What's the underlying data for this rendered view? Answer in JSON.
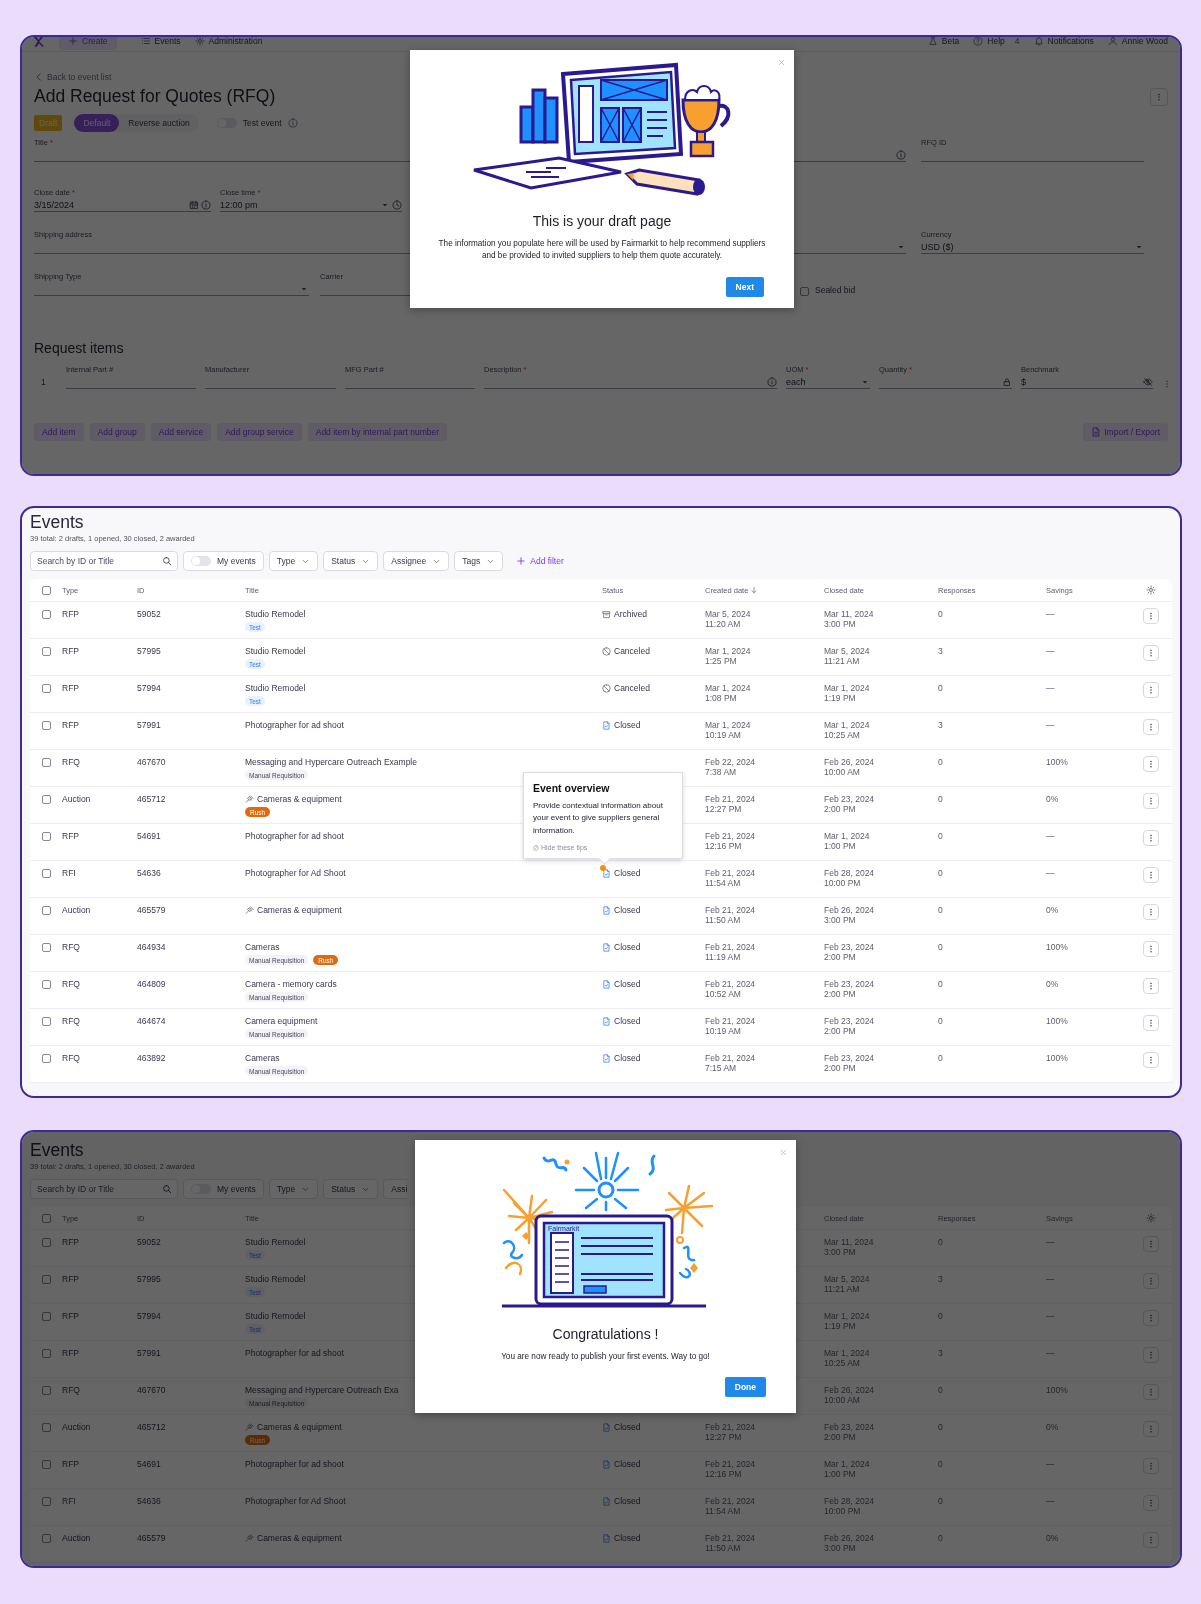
{
  "draft_screen": {
    "nav": {
      "create": "Create",
      "items": [
        {
          "label": "Events"
        },
        {
          "label": "Administration"
        }
      ],
      "right": [
        {
          "label": "Beta"
        },
        {
          "label": "Help",
          "count": "4"
        },
        {
          "label": "Notifications"
        },
        {
          "label": "Annie Wood"
        }
      ]
    },
    "back_link": "Back to event list",
    "title": "Add Request for Quotes (RFQ)",
    "status_badge": "Draft",
    "event_types": [
      {
        "label": "Default",
        "selected": true
      },
      {
        "label": "Reverse auction",
        "selected": false
      }
    ],
    "test_event": {
      "label": "Test event",
      "on": false
    },
    "form": {
      "title_field": {
        "label": "Title",
        "required": "*"
      },
      "rfq_id": {
        "label": "RFQ ID"
      },
      "close_date": {
        "label": "Close date",
        "required": "*",
        "value": "3/15/2024"
      },
      "close_time": {
        "label": "Close time",
        "required": "*",
        "value": "12:00 pm"
      },
      "shipping_address": {
        "label": "Shipping address"
      },
      "currency": {
        "label": "Currency",
        "value": "USD ($)"
      },
      "shipping_type": {
        "label": "Shipping Type"
      },
      "carrier": {
        "label": "Carrier"
      },
      "sealed_bid": {
        "label": "Sealed bid",
        "checked": false
      }
    },
    "request_items": {
      "heading": "Request items",
      "rows": [
        {
          "number": "1",
          "fields": [
            {
              "label": "Internal Part #"
            },
            {
              "label": "Manufacturer"
            },
            {
              "label": "MFG Part #"
            },
            {
              "label": "Description",
              "required": "*"
            },
            {
              "label": "UOM",
              "required": "*",
              "value": "each"
            },
            {
              "label": "Quantity",
              "required": "*"
            },
            {
              "label": "Benchmark",
              "value": "$"
            }
          ]
        }
      ]
    },
    "item_buttons": [
      "Add item",
      "Add group",
      "Add service",
      "Add group service",
      "Add item by internal part number"
    ],
    "import_export": "Import / Export",
    "modal": {
      "title": "This is your draft page",
      "body": "The information you populate here will be used by Fairmarkit to help recommend suppliers and be provided to invited suppliers to help them quote accurately.",
      "button": "Next"
    }
  },
  "event_lists": [
    {
      "title": "Events",
      "summary": "39 total: 2 drafts, 1 opened, 30 closed, 2 awarded",
      "search": {
        "placeholder": "Search by ID or Title"
      },
      "my_events": {
        "label": "My events",
        "on": false
      },
      "filters": [
        {
          "label": "Type",
          "cut": false
        },
        {
          "label": "Status",
          "cut": false
        },
        {
          "label": "Assignee",
          "cut": false
        },
        {
          "label": "Tags",
          "cut": false
        }
      ],
      "add_filter": "Add filter",
      "all_checked": false,
      "columns": [
        {
          "kind": "type",
          "label": "Type",
          "sorted": false
        },
        {
          "kind": "id",
          "label": "ID",
          "sorted": false
        },
        {
          "kind": "title",
          "label": "Title",
          "sorted": false
        },
        {
          "kind": "status",
          "label": "Status",
          "sorted": false
        },
        {
          "kind": "created",
          "label": "Created date",
          "sorted": true
        },
        {
          "kind": "closed",
          "label": "Closed date",
          "sorted": false
        },
        {
          "kind": "responses",
          "label": "Responses",
          "sorted": false
        },
        {
          "kind": "savings",
          "label": "Savings",
          "sorted": false
        }
      ],
      "rows": [
        {
          "type": "RFP",
          "id": "59052",
          "title": "Studio Remodel",
          "gavel": false,
          "tags": [
            {
              "label": "Test",
              "kind": "test"
            }
          ],
          "status": {
            "kind": "archived",
            "label": "Archived"
          },
          "created": {
            "date": "Mar 5, 2024",
            "time": "11:20 AM"
          },
          "closed": {
            "date": "Mar 11, 2024",
            "time": "3:00 PM"
          },
          "responses": "0",
          "savings": "—",
          "checked": false,
          "beacon": false
        },
        {
          "type": "RFP",
          "id": "57995",
          "title": "Studio Remodel",
          "gavel": false,
          "tags": [
            {
              "label": "Test",
              "kind": "test"
            }
          ],
          "status": {
            "kind": "canceled",
            "label": "Canceled"
          },
          "created": {
            "date": "Mar 1, 2024",
            "time": "1:25 PM"
          },
          "closed": {
            "date": "Mar 5, 2024",
            "time": "11:21 AM"
          },
          "responses": "3",
          "savings": "—",
          "checked": false,
          "beacon": false
        },
        {
          "type": "RFP",
          "id": "57994",
          "title": "Studio Remodel",
          "gavel": false,
          "tags": [
            {
              "label": "Test",
              "kind": "test"
            }
          ],
          "status": {
            "kind": "canceled",
            "label": "Canceled"
          },
          "created": {
            "date": "Mar 1, 2024",
            "time": "1:08 PM"
          },
          "closed": {
            "date": "Mar 1, 2024",
            "time": "1:19 PM"
          },
          "responses": "0",
          "savings": "—",
          "checked": false,
          "beacon": false
        },
        {
          "type": "RFP",
          "id": "57991",
          "title": "Photographer for ad shoot",
          "gavel": false,
          "status": {
            "kind": "closed",
            "label": "Closed"
          },
          "created": {
            "date": "Mar 1, 2024",
            "time": "10:19 AM"
          },
          "closed": {
            "date": "Mar 1, 2024",
            "time": "10:25 AM"
          },
          "responses": "3",
          "savings": "—",
          "checked": false,
          "beacon": false
        },
        {
          "type": "RFQ",
          "id": "467670",
          "title": "Messaging and Hypercare Outreach Example",
          "gavel": false,
          "tags": [
            {
              "label": "Manual Requisition",
              "kind": "manual"
            }
          ],
          "created": {
            "date": "Feb 22, 2024",
            "time": "7:38 AM"
          },
          "closed": {
            "date": "Feb 26, 2024",
            "time": "10:00 AM"
          },
          "responses": "0",
          "savings": "100%",
          "checked": false,
          "beacon": false
        },
        {
          "type": "Auction",
          "id": "465712",
          "title": "Cameras & equipment",
          "gavel": true,
          "tags": [
            {
              "label": "Rush",
              "kind": "rush"
            }
          ],
          "created": {
            "date": "Feb 21, 2024",
            "time": "12:27 PM"
          },
          "closed": {
            "date": "Feb 23, 2024",
            "time": "2:00 PM"
          },
          "responses": "0",
          "savings": "0%",
          "checked": false,
          "beacon": false
        },
        {
          "type": "RFP",
          "id": "54691",
          "title": "Photographer for ad shoot",
          "gavel": false,
          "created": {
            "date": "Feb 21, 2024",
            "time": "12:16 PM"
          },
          "closed": {
            "date": "Mar 1, 2024",
            "time": "1:00 PM"
          },
          "responses": "0",
          "savings": "—",
          "checked": false,
          "beacon": false
        },
        {
          "type": "RFI",
          "id": "54636",
          "title": "Photographer for Ad Shoot",
          "gavel": false,
          "status": {
            "kind": "closed",
            "label": "Closed"
          },
          "created": {
            "date": "Feb 21, 2024",
            "time": "11:54 AM"
          },
          "closed": {
            "date": "Feb 28, 2024",
            "time": "10:00 PM"
          },
          "responses": "0",
          "savings": "—",
          "checked": false,
          "beacon": true
        },
        {
          "type": "Auction",
          "id": "465579",
          "title": "Cameras & equipment",
          "gavel": true,
          "status": {
            "kind": "closed",
            "label": "Closed"
          },
          "created": {
            "date": "Feb 21, 2024",
            "time": "11:50 AM"
          },
          "closed": {
            "date": "Feb 26, 2024",
            "time": "3:00 PM"
          },
          "responses": "0",
          "savings": "0%",
          "checked": false,
          "beacon": false
        },
        {
          "type": "RFQ",
          "id": "464934",
          "title": "Cameras",
          "gavel": false,
          "tags": [
            {
              "label": "Manual Requisition",
              "kind": "manual"
            },
            {
              "label": "Rush",
              "kind": "rush"
            }
          ],
          "status": {
            "kind": "closed",
            "label": "Closed"
          },
          "created": {
            "date": "Feb 21, 2024",
            "time": "11:19 AM"
          },
          "closed": {
            "date": "Feb 23, 2024",
            "time": "2:00 PM"
          },
          "responses": "0",
          "savings": "100%",
          "checked": false,
          "beacon": false
        },
        {
          "type": "RFQ",
          "id": "464809",
          "title": "Camera - memory cards",
          "gavel": false,
          "tags": [
            {
              "label": "Manual Requisition",
              "kind": "manual"
            }
          ],
          "status": {
            "kind": "closed",
            "label": "Closed"
          },
          "created": {
            "date": "Feb 21, 2024",
            "time": "10:52 AM"
          },
          "closed": {
            "date": "Feb 23, 2024",
            "time": "2:00 PM"
          },
          "responses": "0",
          "savings": "0%",
          "checked": false,
          "beacon": false
        },
        {
          "type": "RFQ",
          "id": "464674",
          "title": "Camera equipment",
          "gavel": false,
          "tags": [
            {
              "label": "Manual Requisition",
              "kind": "manual"
            }
          ],
          "status": {
            "kind": "closed",
            "label": "Closed"
          },
          "created": {
            "date": "Feb 21, 2024",
            "time": "10:19 AM"
          },
          "closed": {
            "date": "Feb 23, 2024",
            "time": "2:00 PM"
          },
          "responses": "0",
          "savings": "100%",
          "checked": false,
          "beacon": false
        },
        {
          "type": "RFQ",
          "id": "463892",
          "title": "Cameras",
          "gavel": false,
          "tags": [
            {
              "label": "Manual Requisition",
              "kind": "manual"
            }
          ],
          "status": {
            "kind": "closed",
            "label": "Closed"
          },
          "created": {
            "date": "Feb 21, 2024",
            "time": "7:15 AM"
          },
          "closed": {
            "date": "Feb 23, 2024",
            "time": "2:00 PM"
          },
          "responses": "0",
          "savings": "100%",
          "checked": false,
          "beacon": false
        }
      ],
      "tip": {
        "title": "Event overview",
        "body": "Provide contextual information about your event to give suppliers general information.",
        "hide": "Hide these tips"
      }
    },
    {
      "title": "Events",
      "summary": "39 total: 2 drafts, 1 opened, 30 closed, 2 awarded",
      "search": {
        "placeholder": "Search by ID or Title"
      },
      "my_events": {
        "label": "My events",
        "on": false
      },
      "filters": [
        {
          "label": "Type",
          "cut": false
        },
        {
          "label": "Status",
          "cut": false
        },
        {
          "label": "Assi",
          "cut": true
        }
      ],
      "all_checked": false,
      "columns": [
        {
          "kind": "type",
          "label": "Type",
          "sorted": false
        },
        {
          "kind": "id",
          "label": "ID",
          "sorted": false
        },
        {
          "kind": "title",
          "label": "Title",
          "sorted": false
        },
        {
          "kind": "closed",
          "label": "Closed date",
          "sorted": false
        },
        {
          "kind": "responses",
          "label": "Responses",
          "sorted": false
        },
        {
          "kind": "savings",
          "label": "Savings",
          "sorted": false
        }
      ],
      "rows": [
        {
          "type": "RFP",
          "id": "59052",
          "title": "Studio Remodel",
          "gavel": false,
          "tags": [
            {
              "label": "Test",
              "kind": "test"
            }
          ],
          "closed": {
            "date": "Mar 11, 2024",
            "time": "3:00 PM"
          },
          "responses": "0",
          "savings": "—",
          "checked": false,
          "beacon": false
        },
        {
          "type": "RFP",
          "id": "57995",
          "title": "Studio Remodel",
          "gavel": false,
          "tags": [
            {
              "label": "Test",
              "kind": "test"
            }
          ],
          "closed": {
            "date": "Mar 5, 2024",
            "time": "11:21 AM"
          },
          "responses": "3",
          "savings": "—",
          "checked": false,
          "beacon": false
        },
        {
          "type": "RFP",
          "id": "57994",
          "title": "Studio Remodel",
          "gavel": false,
          "tags": [
            {
              "label": "Test",
              "kind": "test"
            }
          ],
          "closed": {
            "date": "Mar 1, 2024",
            "time": "1:19 PM"
          },
          "responses": "0",
          "savings": "—",
          "checked": false,
          "beacon": false
        },
        {
          "type": "RFP",
          "id": "57991",
          "title": "Photographer for ad shoot",
          "gavel": false,
          "closed": {
            "date": "Mar 1, 2024",
            "time": "10:25 AM"
          },
          "responses": "3",
          "savings": "—",
          "checked": false,
          "beacon": false
        },
        {
          "type": "RFQ",
          "id": "467670",
          "title": "Messaging and Hypercare Outreach Exa",
          "gavel": false,
          "tags": [
            {
              "label": "Manual Requisition",
              "kind": "manual"
            }
          ],
          "closed": {
            "date": "Feb 26, 2024",
            "time": "10:00 AM"
          },
          "responses": "0",
          "savings": "100%",
          "checked": false,
          "beacon": false
        },
        {
          "type": "Auction",
          "id": "465712",
          "title": "Cameras & equipment",
          "gavel": true,
          "tags": [
            {
              "label": "Rush",
              "kind": "rush"
            }
          ],
          "status": {
            "kind": "closed",
            "label": "Closed"
          },
          "created": {
            "date": "Feb 21, 2024",
            "time": "12:27 PM"
          },
          "closed": {
            "date": "Feb 23, 2024",
            "time": "2:00 PM"
          },
          "responses": "0",
          "savings": "0%",
          "checked": false,
          "beacon": false
        },
        {
          "type": "RFP",
          "id": "54691",
          "title": "Photographer for ad shoot",
          "gavel": false,
          "status": {
            "kind": "closed",
            "label": "Closed"
          },
          "created": {
            "date": "Feb 21, 2024",
            "time": "12:16 PM"
          },
          "closed": {
            "date": "Mar 1, 2024",
            "time": "1:00 PM"
          },
          "responses": "0",
          "savings": "—",
          "checked": false,
          "beacon": false
        },
        {
          "type": "RFI",
          "id": "54636",
          "title": "Photographer for Ad Shoot",
          "gavel": false,
          "status": {
            "kind": "closed",
            "label": "Closed"
          },
          "created": {
            "date": "Feb 21, 2024",
            "time": "11:54 AM"
          },
          "closed": {
            "date": "Feb 28, 2024",
            "time": "10:00 PM"
          },
          "responses": "0",
          "savings": "—",
          "checked": false,
          "beacon": false
        },
        {
          "type": "Auction",
          "id": "465579",
          "title": "Cameras & equipment",
          "gavel": true,
          "status": {
            "kind": "closed",
            "label": "Closed"
          },
          "created": {
            "date": "Feb 21, 2024",
            "time": "11:50 AM"
          },
          "closed": {
            "date": "Feb 26, 2024",
            "time": "3:00 PM"
          },
          "responses": "0",
          "savings": "0%",
          "checked": false,
          "beacon": false
        }
      ],
      "modal": {
        "title": "Congratulations !",
        "body": "You are now ready to publish your first events. Way to go!",
        "button": "Done",
        "screen_label": "Fairmarkit"
      }
    }
  ]
}
